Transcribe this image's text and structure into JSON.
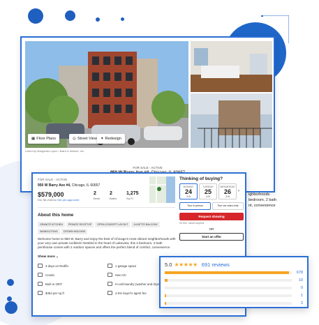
{
  "listing": {
    "photo_buttons": [
      {
        "label": "Floor Plans"
      },
      {
        "label": "Street View"
      },
      {
        "label": "Redesign"
      }
    ],
    "photo_credit": "Listed by Margarita Lopez • Baird & Warner, Inc.",
    "status": "FOR SALE - ACTIVE",
    "address_bold": "950 W Barry Ave #4,",
    "address_rest": " Chicago, IL 60657"
  },
  "details": {
    "status": "FOR SALE - ACTIVE",
    "address_bold": "950 W Barry Ave #4,",
    "address_rest": " Chicago, IL 60657",
    "price": "$579,000",
    "est_payment": "Est. $4,216/mo",
    "get_preapproved": "Get pre-approved",
    "stats": [
      {
        "value": "2",
        "label": "Beds"
      },
      {
        "value": "2",
        "label": "Baths"
      },
      {
        "value": "1,275",
        "label": "Sq Ft"
      }
    ],
    "about_title": "About this home",
    "tags": [
      "GRANITE KITCHEN",
      "PRIVATE ROOFTOP",
      "OPEN-CONCEPT LAYOUT",
      "JULIETTE BALCONY",
      "WAINSCOTING",
      "CROWN MOLDING"
    ],
    "description": "Welcome home to 950 W. Barry and enjoy the best of Chicago's most vibrant neighborhoods with your very own private roofdeck! Nestled in the heart of Lakeview, this 2 bedroom, 2 bath penthouse comes with 2 outdoor spaces and offers the perfect blend of comfort, convenience",
    "show_more": "Show more",
    "facts": [
      {
        "text": "3 days on Redfin"
      },
      {
        "text": "1 garage space"
      },
      {
        "text": "Condo"
      },
      {
        "text": "Has A/C"
      },
      {
        "text": "Built in 2007"
      },
      {
        "text": "In-unit laundry (washer and dryer)"
      },
      {
        "text": "$454 per sq ft"
      },
      {
        "text": "2.5% buyer's agent fee"
      }
    ]
  },
  "tour": {
    "title": "Thinking of buying?",
    "days": [
      {
        "name": "MONDAY",
        "date": "24",
        "month": "JUN",
        "selected": true
      },
      {
        "name": "TUESDAY",
        "date": "25",
        "month": "JUN",
        "selected": false
      },
      {
        "name": "WEDNESDAY",
        "date": "26",
        "month": "JUN",
        "selected": false
      }
    ],
    "tour_types": [
      {
        "label": "Tour in person",
        "selected": true
      },
      {
        "label": "Tour via video chat",
        "selected": false
      }
    ],
    "request_label": "Request showing",
    "request_note": "It's free, cancel anytime",
    "or_label": "OR",
    "offer_label": "Start an offer"
  },
  "reviews": {
    "score": "5.0",
    "stars": "★★★★★",
    "count": "691 reviews",
    "bars": [
      {
        "star": "5",
        "count": "678",
        "fraction": 0.98
      },
      {
        "star": "4",
        "count": "10",
        "fraction": 0.02
      },
      {
        "star": "3",
        "count": "0",
        "fraction": 0.0
      },
      {
        "star": "2",
        "count": "1",
        "fraction": 0.01
      },
      {
        "star": "1",
        "count": "2",
        "fraction": 0.01
      }
    ]
  },
  "right_peek": {
    "tag": "WAINSCOTING",
    "text": "ighborhoods\nbedroom, 2 bath\nnt, convenience"
  },
  "colors": {
    "accent": "#2a6fd6",
    "request": "#d6262b",
    "star": "#f5a623"
  }
}
